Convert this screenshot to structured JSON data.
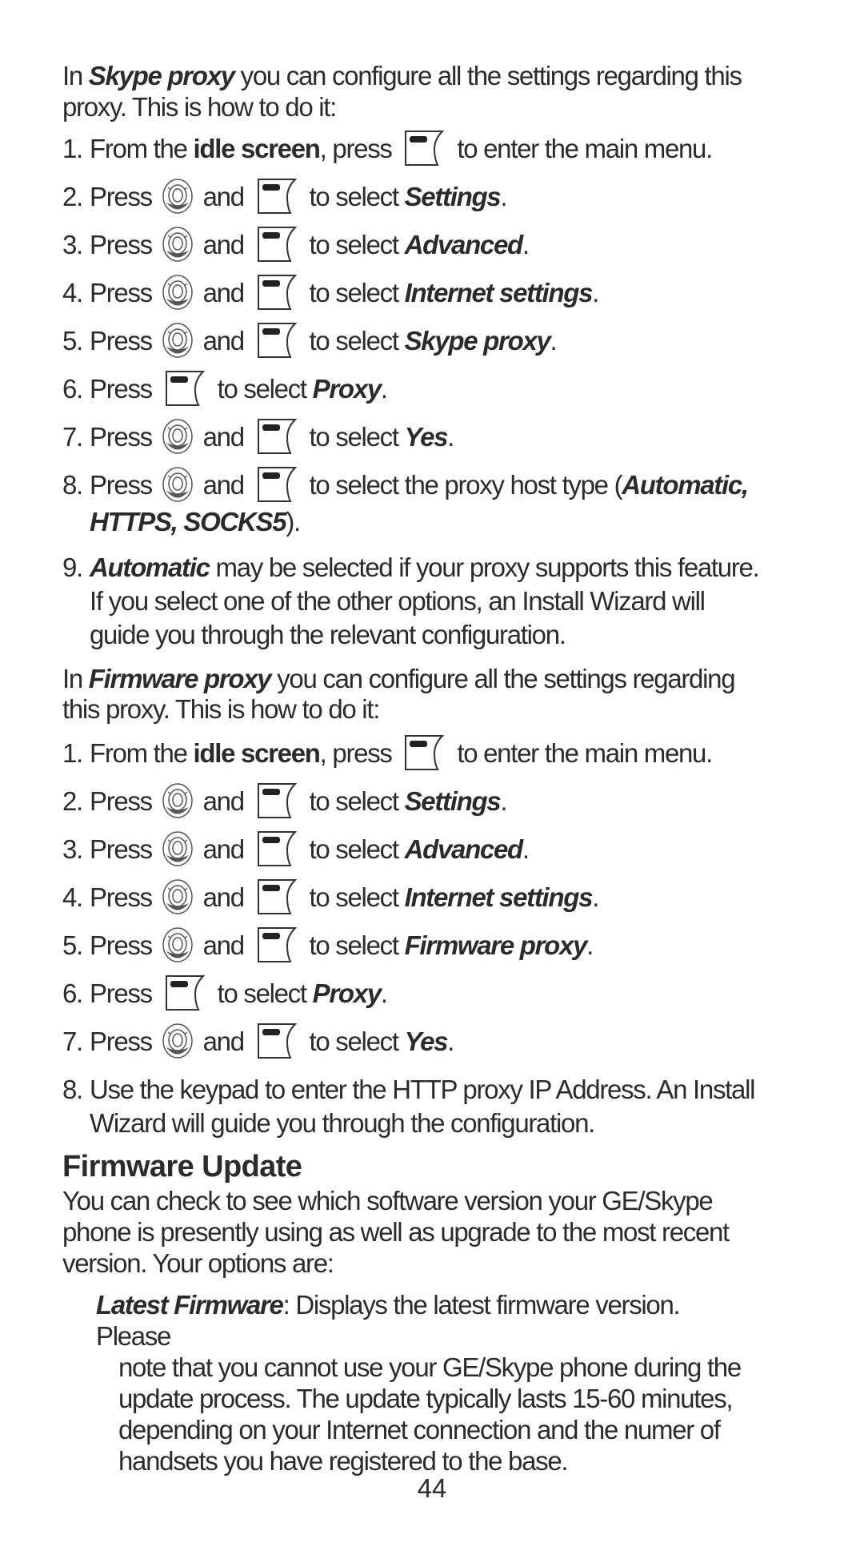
{
  "skype_section": {
    "intro_prefix": "In ",
    "intro_term": "Skype proxy",
    "intro_suffix": " you can configure all the settings regarding this",
    "intro_line2": "proxy. This is how to do it:",
    "steps": [
      {
        "num": "1.",
        "pre": "From the ",
        "bold": "idle screen",
        "mid": ", press ",
        "post": " to enter the main menu."
      },
      {
        "num": "2.",
        "pre": "Press ",
        "and": " and ",
        "post": " to select ",
        "target": "Settings",
        "end": "."
      },
      {
        "num": "3.",
        "pre": "Press ",
        "and": " and ",
        "post": " to select ",
        "target": "Advanced",
        "end": "."
      },
      {
        "num": "4.",
        "pre": "Press ",
        "and": " and ",
        "post": " to select ",
        "target": "Internet settings",
        "end": "."
      },
      {
        "num": "5.",
        "pre": "Press ",
        "and": " and ",
        "post": " to select ",
        "target": "Skype proxy",
        "end": "."
      },
      {
        "num": "6.",
        "pre": "Press ",
        "post": " to select ",
        "target": "Proxy",
        "end": "."
      },
      {
        "num": "7.",
        "pre": "Press ",
        "and": " and ",
        "post": " to select ",
        "target": "Yes",
        "end": "."
      },
      {
        "num": "8.",
        "pre": "Press ",
        "and": " and ",
        "post": " to select the proxy host type (",
        "target": "Automatic,",
        "line2": "HTTPS, SOCKS5",
        "end": ")."
      },
      {
        "num": "9.",
        "term": "Automatic",
        "text": " may be selected if your proxy supports this feature.",
        "line2": "If you select one of the other options, an Install Wizard will",
        "line3": "guide you through the relevant configuration."
      }
    ]
  },
  "firmware_proxy_section": {
    "intro_prefix": "In ",
    "intro_term": "Firmware proxy",
    "intro_suffix": " you can configure all the settings regarding",
    "intro_line2": "this proxy. This is how to do it:",
    "steps": [
      {
        "num": "1.",
        "pre": "From the ",
        "bold": "idle screen",
        "mid": ", press ",
        "post": " to enter the main menu."
      },
      {
        "num": "2.",
        "pre": "Press ",
        "and": " and ",
        "post": " to select ",
        "target": "Settings",
        "end": "."
      },
      {
        "num": "3.",
        "pre": "Press ",
        "and": " and ",
        "post": " to select ",
        "target": "Advanced",
        "end": "."
      },
      {
        "num": "4.",
        "pre": "Press ",
        "and": " and ",
        "post": " to select ",
        "target": "Internet settings",
        "end": "."
      },
      {
        "num": "5.",
        "pre": "Press ",
        "and": " and ",
        "post": " to select ",
        "target": "Firmware proxy",
        "end": "."
      },
      {
        "num": "6.",
        "pre": "Press ",
        "post": " to select ",
        "target": "Proxy",
        "end": "."
      },
      {
        "num": "7.",
        "pre": "Press ",
        "and": " and ",
        "post": " to select ",
        "target": "Yes",
        "end": "."
      },
      {
        "num": "8.",
        "text": "Use the keypad to enter the HTTP proxy IP Address. An Install",
        "line2": "Wizard will guide you through the configuration."
      }
    ]
  },
  "firmware_update": {
    "heading": "Firmware Update",
    "para_line1": "You can check to see which software version your GE/Skype",
    "para_line2": "phone is presently using as well as upgrade to the most recent",
    "para_line3": "version. Your options are:",
    "option_term": "Latest Firmware",
    "option_line1": ": Displays the latest firmware version. Please",
    "option_line2": "note that you cannot use your GE/Skype phone during the",
    "option_line3": "update process. The update typically lasts 15-60 minutes,",
    "option_line4": "depending on your Internet connection and the numer of",
    "option_line5": "handsets you have registered to the base."
  },
  "icons": {
    "nav": "navigation-key-icon",
    "softkey": "softkey-icon"
  },
  "page_number": "44"
}
